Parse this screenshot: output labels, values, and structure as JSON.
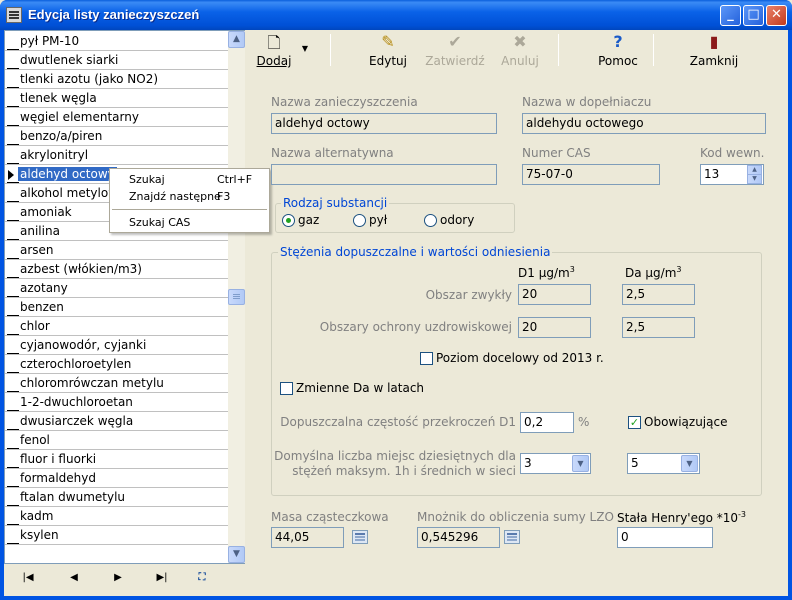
{
  "window": {
    "title": "Edycja listy zanieczyszczeń"
  },
  "list": {
    "items": [
      "pył PM-10",
      "dwutlenek siarki",
      "tlenki azotu (jako NO2)",
      "tlenek węgla",
      "węgiel elementarny",
      "benzo/a/piren",
      "akrylonitryl",
      "aldehyd octowy",
      "alkohol metylowy",
      "amoniak",
      "anilina",
      "arsen",
      "azbest (włókien/m3)",
      "azotany",
      "benzen",
      "chlor",
      "cyjanowodór, cyjanki",
      "czterochloroetylen",
      "chloromrówczan metylu",
      "1-2-dwuchloroetan",
      "dwusiarczek węgla",
      "fenol",
      "fluor i fluorki",
      "formaldehyd",
      "ftalan dwumetylu",
      "kadm",
      "ksylen"
    ],
    "selected_index": 7
  },
  "context_menu": {
    "items": [
      {
        "label": "Szukaj",
        "shortcut": "Ctrl+F"
      },
      {
        "label": "Znajdź następne",
        "shortcut": "F3"
      },
      {
        "label": "Szukaj CAS",
        "shortcut": ""
      }
    ]
  },
  "toolbar": {
    "add": "Dodaj",
    "edit": "Edytuj",
    "confirm": "Zatwierdź",
    "cancel": "Anuluj",
    "help": "Pomoc",
    "close": "Zamknij"
  },
  "form": {
    "name_label": "Nazwa zanieczyszczenia",
    "name_value": "aldehyd octowy",
    "genitive_label": "Nazwa w dopełniaczu",
    "genitive_value": "aldehydu octowego",
    "alt_label": "Nazwa alternatywna",
    "alt_value": "",
    "cas_label": "Numer CAS",
    "cas_value": "75-07-0",
    "code_label": "Kod wewn.",
    "code_value": "13",
    "substance_group": "Rodzaj substancji",
    "substance_options": [
      "gaz",
      "pył",
      "odory"
    ],
    "substance_selected": "gaz",
    "conc_group": "Stężenia dopuszczalne i wartości odniesienia",
    "d1_header": "D1 µg/m",
    "da_header": "Da µg/m",
    "cube": "3",
    "area_normal_label": "Obszar zwykły",
    "area_normal_d1": "20",
    "area_normal_da": "2,5",
    "area_spa_label": "Obszary ochrony uzdrowiskowej",
    "area_spa_d1": "20",
    "area_spa_da": "2,5",
    "target_level_label": "Poziom docelowy od 2013 r.",
    "target_level_checked": false,
    "variable_da_label": "Zmienne Da w latach",
    "variable_da_checked": false,
    "freq_label": "Dopuszczalna częstość przekroczeń D1",
    "freq_value": "0,2",
    "freq_unit": "%",
    "mandatory_label": "Obowiązujące",
    "mandatory_checked": true,
    "decimals_label_1": "Domyślna liczba miejsc dziesiętnych dla",
    "decimals_label_2": "stężeń maksym. 1h i średnich  w sieci",
    "decimals_1h": "3",
    "decimals_avg": "5",
    "molar_label": "Masa cząsteczkowa",
    "molar_value": "44,05",
    "lzo_label": "Mnożnik do obliczenia sumy LZO",
    "lzo_value": "0,545296",
    "henry_label": "Stała Henry'ego *10",
    "henry_exp": "-3",
    "henry_value": "0"
  }
}
